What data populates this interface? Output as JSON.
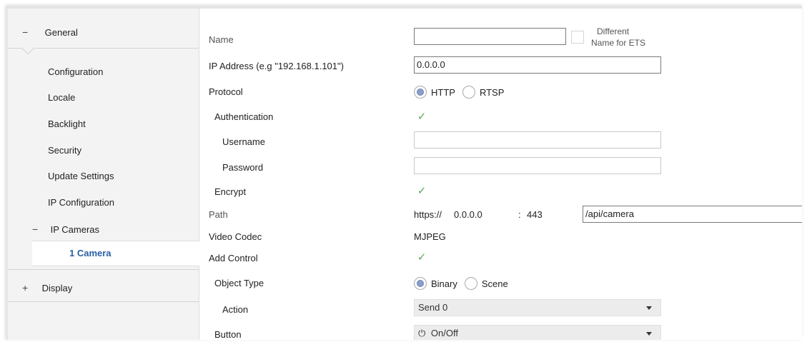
{
  "sidebar": {
    "general": {
      "sign": "−",
      "label": "General"
    },
    "items": [
      {
        "label": "Configuration"
      },
      {
        "label": "Locale"
      },
      {
        "label": "Backlight"
      },
      {
        "label": "Security"
      },
      {
        "label": "Update Settings"
      },
      {
        "label": "IP Configuration"
      }
    ],
    "ip_cameras": {
      "sign": "−",
      "label": "IP Cameras"
    },
    "camera": {
      "label": "1 Camera"
    },
    "display": {
      "sign": "+",
      "label": "Display"
    },
    "accent_color": "#2b5fa5"
  },
  "form": {
    "name": {
      "label": "Name",
      "value": "",
      "different_label_line1": "Different",
      "different_label_line2": "Name for ETS"
    },
    "ip_address": {
      "label": "IP Address (e.g \"192.168.1.101\")",
      "value": "0.0.0.0"
    },
    "protocol": {
      "label": "Protocol",
      "options": [
        "HTTP",
        "RTSP"
      ],
      "selected": "HTTP"
    },
    "authentication": {
      "label": "Authentication",
      "checked": true
    },
    "username": {
      "label": "Username",
      "value": ""
    },
    "password": {
      "label": "Password",
      "value": ""
    },
    "encrypt": {
      "label": "Encrypt",
      "checked": true
    },
    "path": {
      "label": "Path",
      "prefix": "https://",
      "host": "0.0.0.0",
      "port_sep": ":",
      "port": "443",
      "value": "/api/camera"
    },
    "video_codec": {
      "label": "Video Codec",
      "value": "MJPEG"
    },
    "add_control": {
      "label": "Add Control",
      "checked": true
    },
    "object_type": {
      "label": "Object Type",
      "options": [
        "Binary",
        "Scene"
      ],
      "selected": "Binary"
    },
    "action": {
      "label": "Action",
      "value": "Send 0"
    },
    "button": {
      "label": "Button",
      "value": "On/Off",
      "icon": "power-icon"
    }
  },
  "check_glyph": "✓",
  "power_glyph": "⏻"
}
